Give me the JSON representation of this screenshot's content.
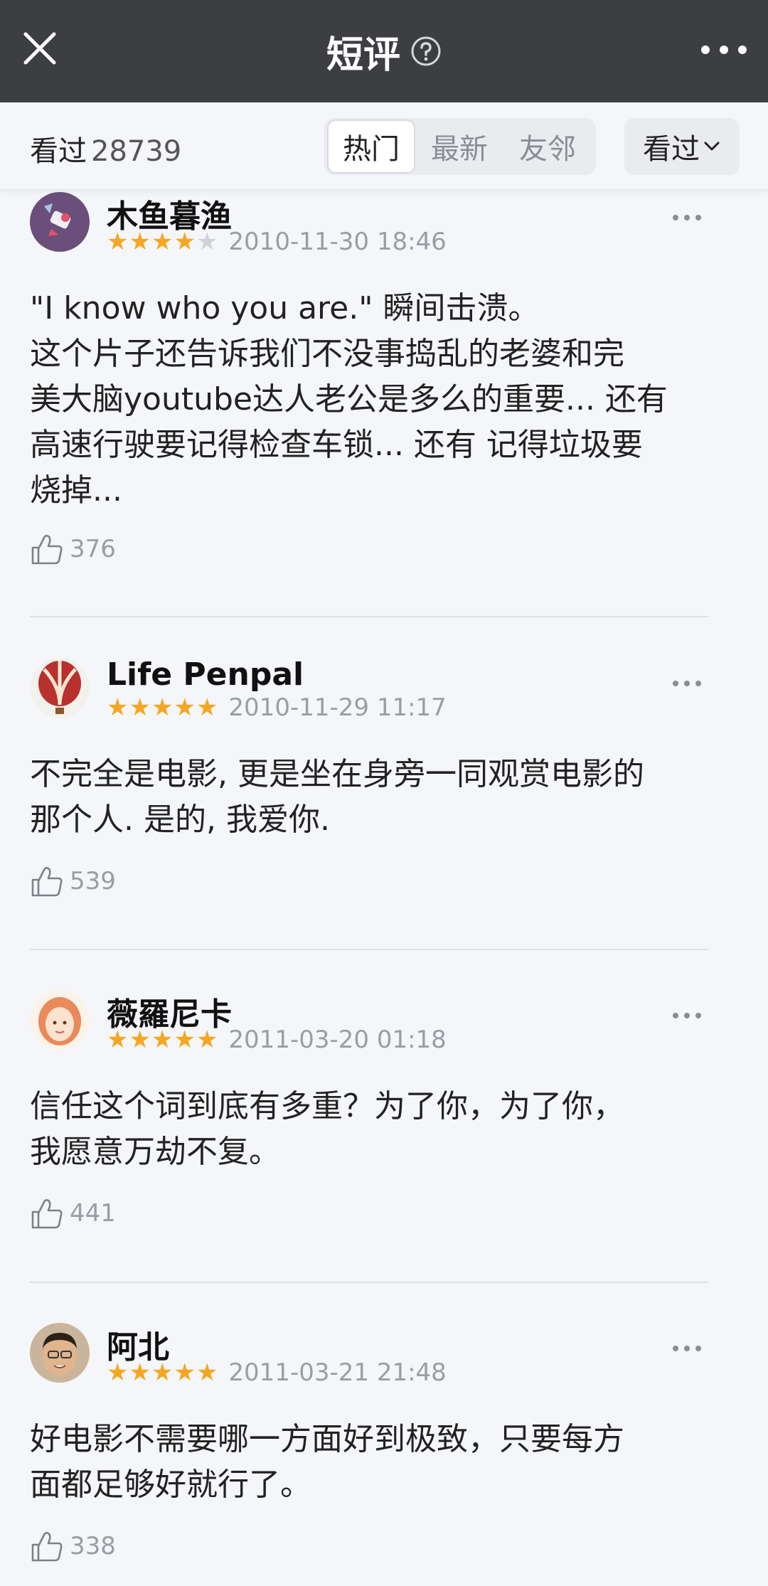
{
  "header": {
    "title": "短评",
    "close_icon": "close-icon",
    "help_icon": "help-circle-icon",
    "more_icon": "more-horizontal-icon"
  },
  "filter": {
    "count_label": "看过",
    "count_value": "28739",
    "tabs": [
      {
        "label": "热门",
        "active": true
      },
      {
        "label": "最新",
        "active": false
      },
      {
        "label": "友邻",
        "active": false
      }
    ],
    "dropdown_label": "看过"
  },
  "comments": [
    {
      "user": "木鱼暮渔",
      "rating": 4,
      "time": "2010-11-30 18:46",
      "text": "\"I know who you are.\" 瞬间击溃。\n这个片子还告诉我们不没事捣乱的老婆和完\n美大脑youtube达人老公是多么的重要... 还有\n高速行驶要记得检查车锁... 还有 记得垃圾要\n烧掉...",
      "likes": "376"
    },
    {
      "user": "Life Penpal",
      "rating": 5,
      "time": "2010-11-29 11:17",
      "text": "不完全是电影, 更是坐在身旁一同观赏电影的\n那个人. 是的, 我爱你.",
      "likes": "539"
    },
    {
      "user": "薇羅尼卡",
      "rating": 5,
      "time": "2011-03-20 01:18",
      "text": "信任这个词到底有多重？为了你，为了你，\n我愿意万劫不复。",
      "likes": "441"
    },
    {
      "user": "阿北",
      "rating": 5,
      "time": "2011-03-21 21:48",
      "text": "好电影不需要哪一方面好到极致，只要每方\n面都足够好就行了。",
      "likes": "338"
    }
  ],
  "colors": {
    "nav_bg": "#3c3e42",
    "star": "#f5a623",
    "muted": "#9a9da3"
  }
}
